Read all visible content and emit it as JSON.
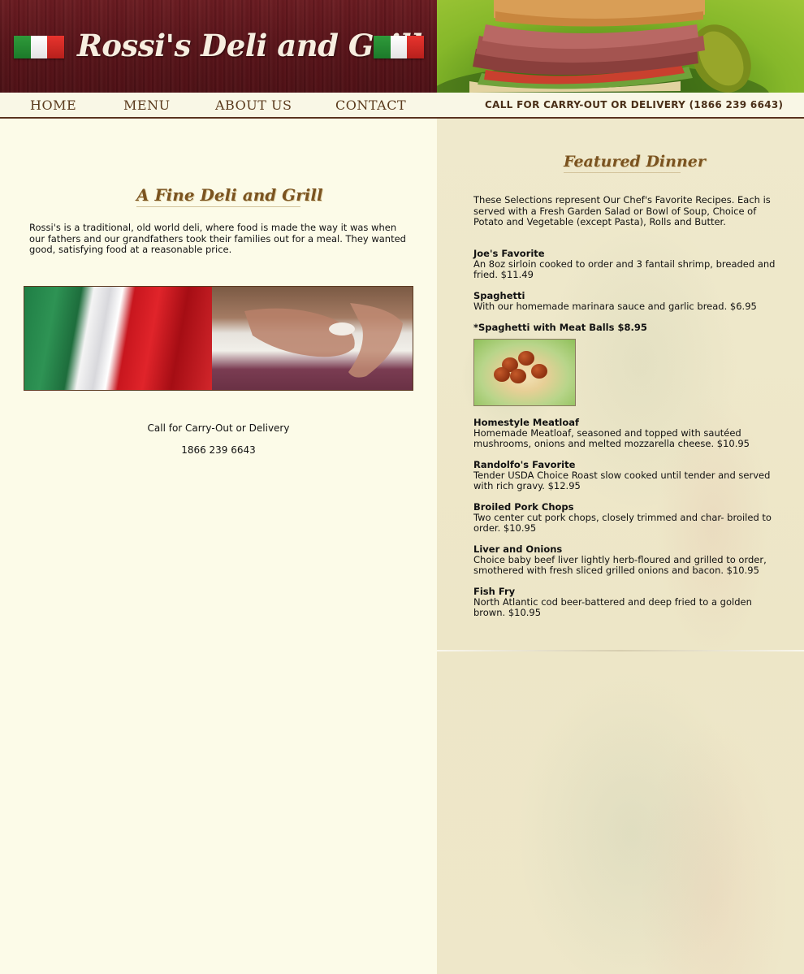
{
  "header": {
    "site_title": "Rossi's Deli and Grill"
  },
  "nav": {
    "items": [
      {
        "label": "HOME"
      },
      {
        "label": "MENU"
      },
      {
        "label": "ABOUT US"
      },
      {
        "label": "CONTACT"
      }
    ],
    "phone_callout": "CALL FOR CARRY-OUT OR DELIVERY (1866 239 6643)"
  },
  "left": {
    "heading": "A Fine Deli and Grill",
    "intro": "Rossi's is a traditional, old world deli, where food is made the way it was when our fathers and our grandfathers took their families out for a meal. They wanted good, satisfying food at a reasonable price.",
    "contact_label": "Call for Carry-Out or Delivery",
    "contact_phone": "1866 239 6643"
  },
  "right": {
    "heading": "Featured Dinner",
    "intro": "These Selections represent Our Chef's Favorite Recipes. Each is served with a Fresh Garden Salad or Bowl of Soup, Choice of Potato and Vegetable (except Pasta), Rolls and Butter.",
    "menu_items": [
      {
        "name": "Joe's Favorite",
        "description": "An 8oz sirloin cooked to order and 3 fantail shrimp, breaded and fried. $11.49"
      },
      {
        "name": "Spaghetti",
        "description": "With our homemade marinara sauce and garlic bread. $6.95"
      },
      {
        "name": "*Spaghetti with Meat Balls $8.95",
        "description": ""
      },
      {
        "name": "Homestyle Meatloaf",
        "description": "Homemade Meatloaf, seasoned and topped with sautéed mushrooms, onions and melted mozzarella cheese. $10.95"
      },
      {
        "name": "Randolfo's Favorite",
        "description": "Tender USDA Choice Roast slow cooked until tender and served with rich gravy. $12.95"
      },
      {
        "name": "Broiled Pork Chops",
        "description": "Two center cut pork chops, closely trimmed and char- broiled to order. $10.95"
      },
      {
        "name": "Liver and Onions",
        "description": "Choice baby beef liver lightly herb-floured and grilled to order, smothered with fresh sliced grilled onions and bacon. $10.95"
      },
      {
        "name": "Fish Fry",
        "description": "North Atlantic cod beer-battered and deep fried to a golden brown. $10.95"
      }
    ]
  },
  "colors": {
    "wood_red": "#5a161b",
    "nav_text": "#5a3a1c",
    "heading_brown": "#7a5320",
    "page_cream": "#fcfbe8",
    "parchment": "#efe9cc"
  }
}
